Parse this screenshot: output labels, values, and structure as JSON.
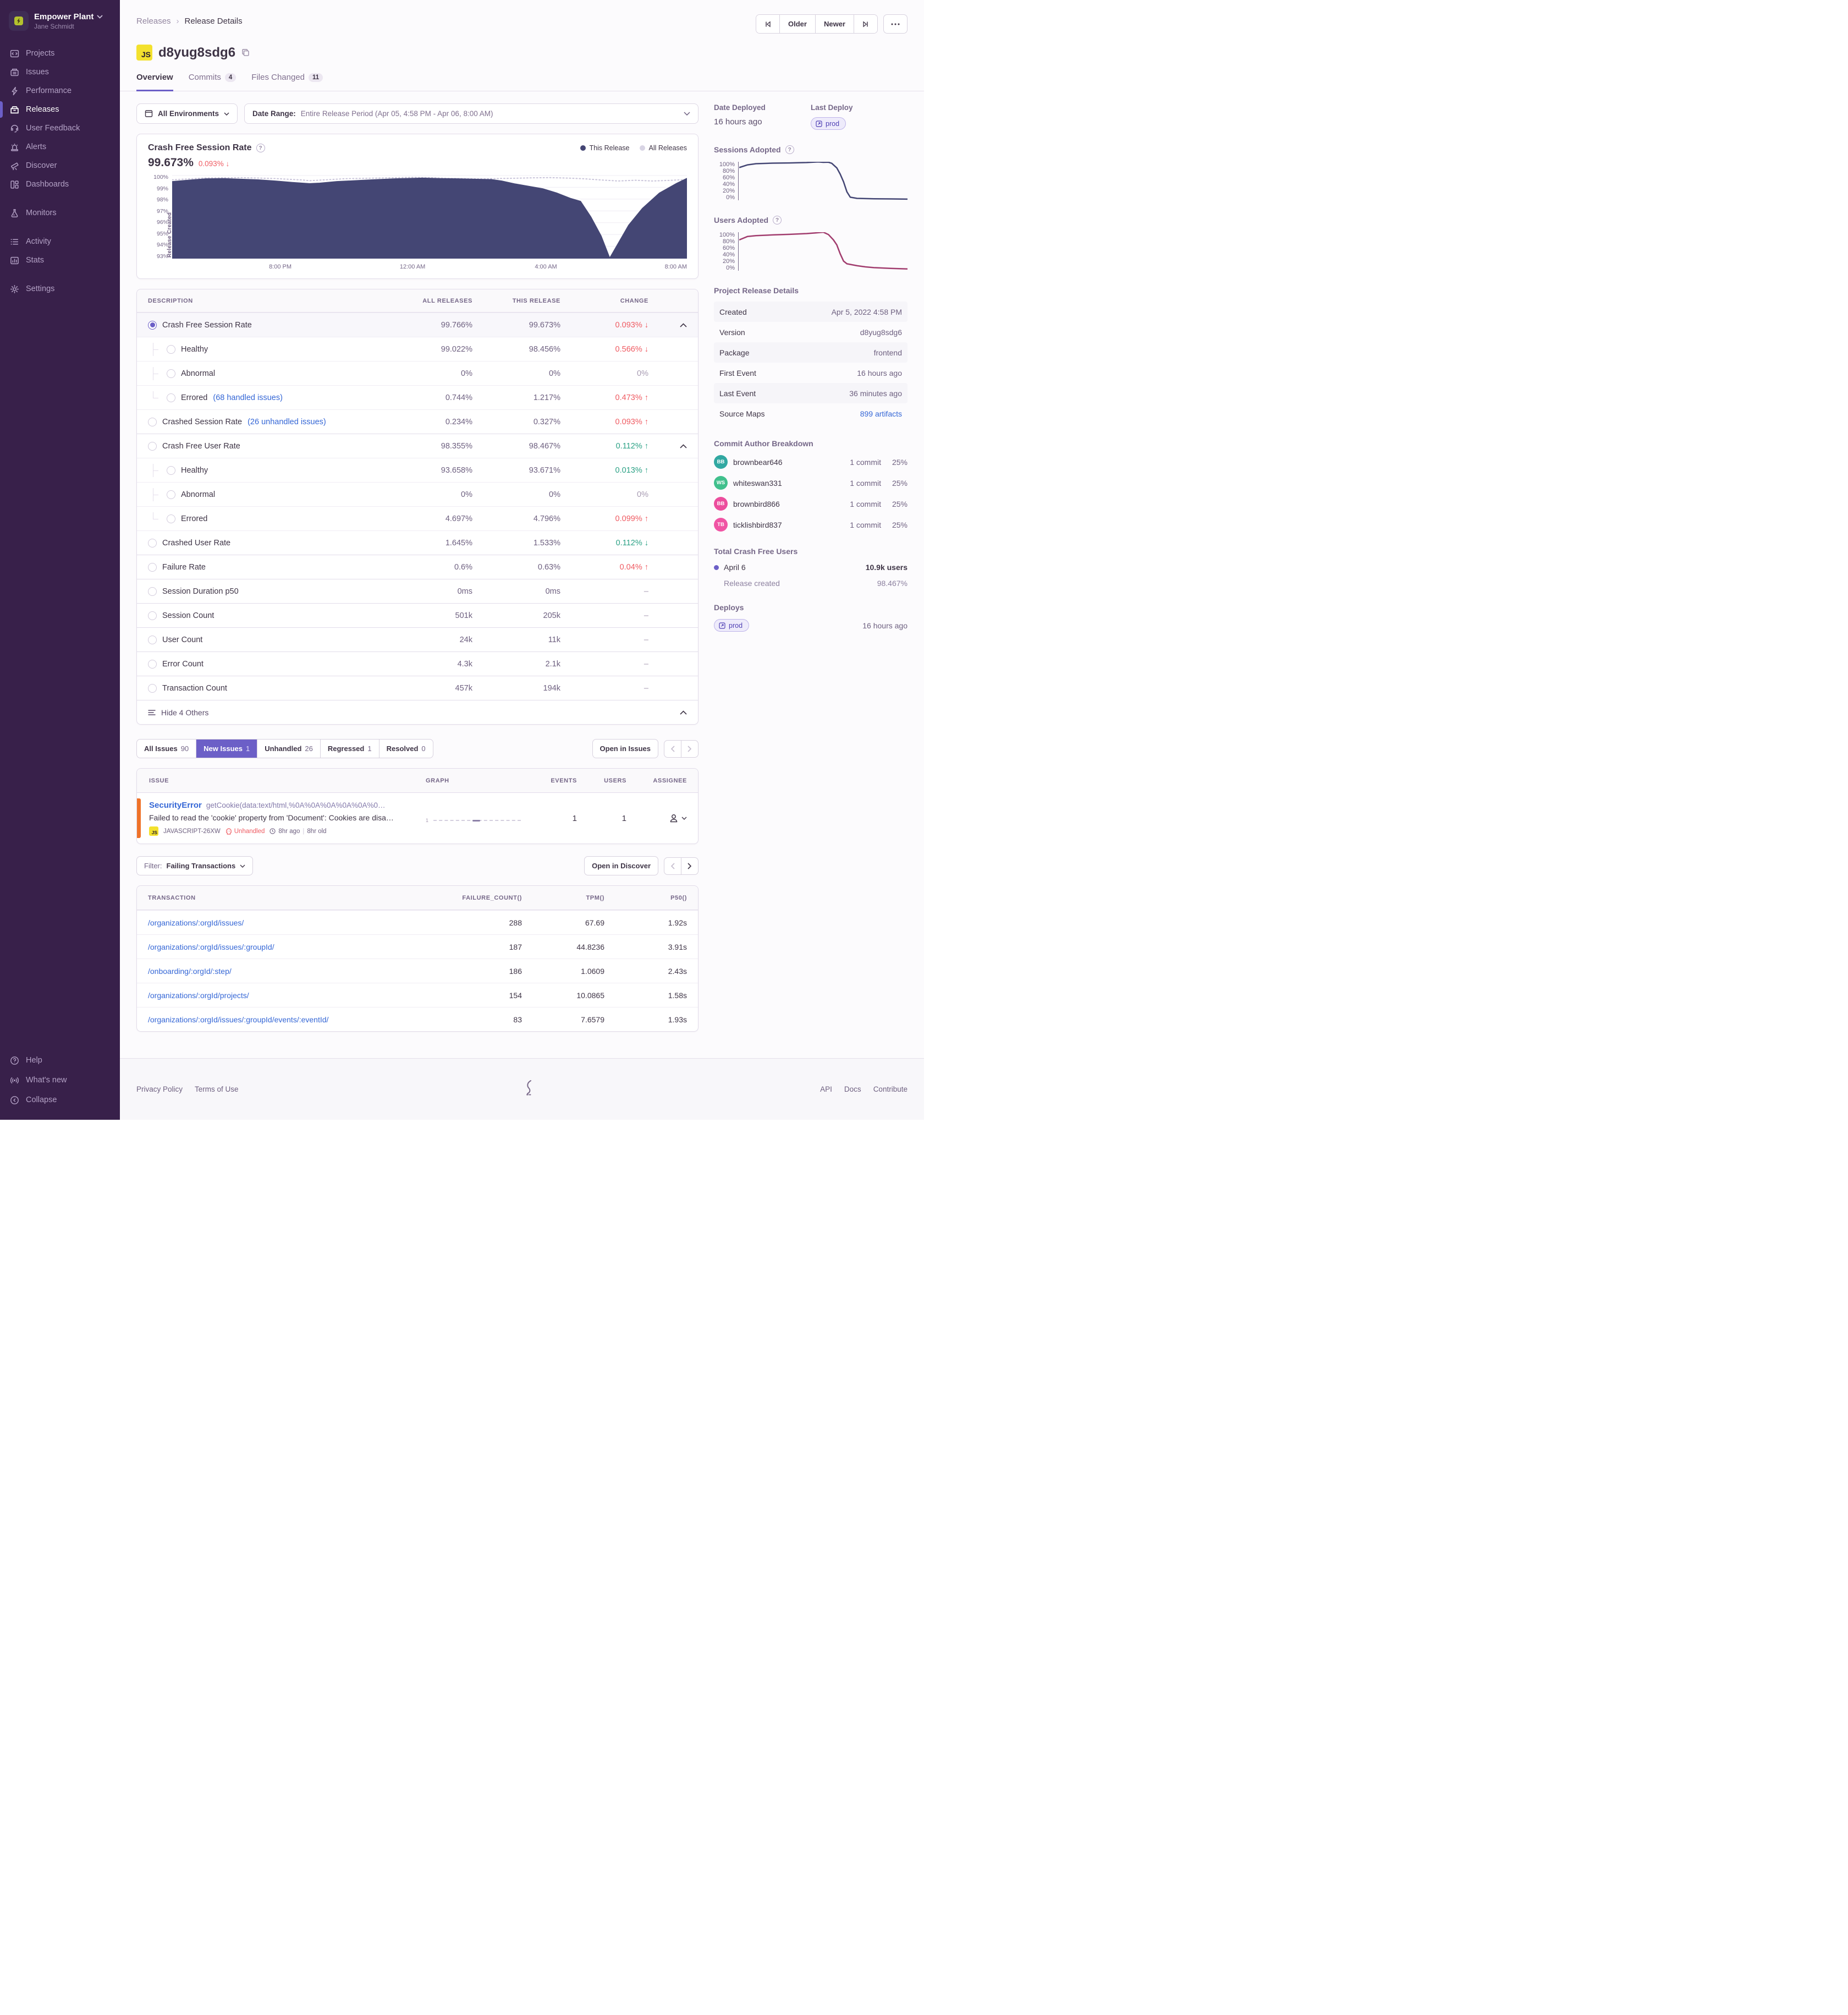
{
  "colors": {
    "accent_purple": "#6c5fc7",
    "sidebar_bg": "#38204a",
    "chart_navy": "#444674",
    "chart_magenta": "#a13c6e",
    "all_releases_line": "#c9c4da",
    "red": "#ef5b62",
    "green": "#2ba185",
    "link_blue": "#3567d6",
    "js_badge_yellow": "#f3e12e",
    "issue_level_orange": "#ef7229"
  },
  "sidebar": {
    "org_name": "Empower Plant",
    "user_name": "Jane Schmidt",
    "items": [
      {
        "label": "Projects"
      },
      {
        "label": "Issues"
      },
      {
        "label": "Performance"
      },
      {
        "label": "Releases"
      },
      {
        "label": "User Feedback"
      },
      {
        "label": "Alerts"
      },
      {
        "label": "Discover"
      },
      {
        "label": "Dashboards"
      },
      {
        "label": "Monitors"
      },
      {
        "label": "Activity"
      },
      {
        "label": "Stats"
      },
      {
        "label": "Settings"
      }
    ],
    "footer_items": [
      {
        "label": "Help"
      },
      {
        "label": "What's new"
      },
      {
        "label": "Collapse"
      }
    ]
  },
  "topbar": {
    "breadcrumb": [
      "Releases",
      "Release Details"
    ],
    "older_label": "Older",
    "newer_label": "Newer"
  },
  "header": {
    "project_badge": "JS",
    "title": "d8yug8sdg6",
    "tabs": [
      {
        "label": "Overview",
        "count": ""
      },
      {
        "label": "Commits",
        "count": "4"
      },
      {
        "label": "Files Changed",
        "count": "11"
      }
    ]
  },
  "filters": {
    "environments": "All Environments",
    "date_range_label": "Date Range:",
    "date_range_value": "Entire Release Period (Apr 05, 4:58 PM - Apr 06, 8:00 AM)"
  },
  "crash_chart": {
    "title": "Crash Free Session Rate",
    "value": "99.673%",
    "delta": "0.093% ↓",
    "legend": [
      {
        "label": "This Release"
      },
      {
        "label": "All Releases"
      }
    ],
    "y_ticks": [
      "100%",
      "99%",
      "98%",
      "97%",
      "96%",
      "95%",
      "94%",
      "93%"
    ],
    "x_ticks": [
      "8:00 PM",
      "12:00 AM",
      "4:00 AM",
      "8:00 AM"
    ],
    "annotation": "Release Created"
  },
  "chart_data": {
    "crash_free_sessions": {
      "type": "area",
      "title": "Crash Free Session Rate (%) over release period Apr 05 4:58 PM - Apr 06 8:00 AM",
      "xlim": [
        0,
        15
      ],
      "ylim": [
        93,
        100
      ],
      "grid_lines": 8,
      "x_tick_labels": [
        "8:00 PM",
        "12:00 AM",
        "4:00 AM",
        "8:00 AM"
      ],
      "series": [
        {
          "name": "All Releases",
          "color": "#c9c4da",
          "width": 2,
          "dash": "2 4",
          "points": [
            [
              0,
              99.6
            ],
            [
              1,
              99.75
            ],
            [
              2,
              99.78
            ],
            [
              3,
              99.7
            ],
            [
              3.8,
              99.58
            ],
            [
              4,
              99.52
            ],
            [
              4.5,
              99.6
            ],
            [
              5,
              99.68
            ],
            [
              6,
              99.74
            ],
            [
              7,
              99.8
            ],
            [
              7.5,
              99.78
            ],
            [
              8,
              99.72
            ],
            [
              8.5,
              99.7
            ],
            [
              9,
              99.68
            ],
            [
              9.5,
              99.7
            ],
            [
              10,
              99.73
            ],
            [
              10.5,
              99.76
            ],
            [
              11,
              99.78
            ],
            [
              11.5,
              99.74
            ],
            [
              12,
              99.68
            ],
            [
              12.5,
              99.58
            ],
            [
              13,
              99.5
            ],
            [
              13.5,
              99.56
            ],
            [
              14,
              99.5
            ],
            [
              14.5,
              99.55
            ],
            [
              15,
              99.62
            ]
          ]
        },
        {
          "name": "This Release",
          "color": "#444674",
          "width": 1.5,
          "area": true,
          "points": [
            [
              0,
              99.45
            ],
            [
              0.6,
              99.6
            ],
            [
              1,
              99.68
            ],
            [
              1.5,
              99.7
            ],
            [
              2,
              99.65
            ],
            [
              2.5,
              99.6
            ],
            [
              3,
              99.5
            ],
            [
              3.5,
              99.38
            ],
            [
              4,
              99.28
            ],
            [
              4.3,
              99.32
            ],
            [
              4.8,
              99.45
            ],
            [
              5.5,
              99.55
            ],
            [
              6,
              99.62
            ],
            [
              6.5,
              99.68
            ],
            [
              7,
              99.72
            ],
            [
              7.3,
              99.74
            ],
            [
              7.8,
              99.7
            ],
            [
              8.3,
              99.68
            ],
            [
              8.8,
              99.65
            ],
            [
              9.3,
              99.62
            ],
            [
              9.6,
              99.5
            ],
            [
              10,
              99.25
            ],
            [
              10.4,
              99.05
            ],
            [
              10.8,
              98.85
            ],
            [
              11.2,
              98.5
            ],
            [
              11.6,
              98.05
            ],
            [
              11.9,
              97.8
            ],
            [
              12.2,
              96.5
            ],
            [
              12.5,
              94.9
            ],
            [
              12.75,
              93.05
            ],
            [
              13,
              94.3
            ],
            [
              13.3,
              95.8
            ],
            [
              13.7,
              97.2
            ],
            [
              14.2,
              98.5
            ],
            [
              14.7,
              99.3
            ],
            [
              15,
              99.72
            ]
          ]
        }
      ]
    },
    "sessions_adopted": {
      "type": "line",
      "title": "Sessions Adopted (%)",
      "xlim": [
        0,
        1
      ],
      "ylim": [
        0,
        100
      ],
      "grid_lines": 0,
      "series": [
        {
          "name": "Sessions Adopted",
          "color": "#444674",
          "width": 2.5,
          "points": [
            [
              0,
              85
            ],
            [
              0.05,
              92
            ],
            [
              0.1,
              95
            ],
            [
              0.2,
              96.5
            ],
            [
              0.3,
              97
            ],
            [
              0.4,
              98
            ],
            [
              0.47,
              99.5
            ],
            [
              0.5,
              98.5
            ],
            [
              0.53,
              98.8
            ],
            [
              0.55,
              96
            ],
            [
              0.58,
              84
            ],
            [
              0.6,
              68
            ],
            [
              0.62,
              48
            ],
            [
              0.64,
              22
            ],
            [
              0.66,
              8
            ],
            [
              0.7,
              5
            ],
            [
              0.8,
              4
            ],
            [
              0.9,
              3.5
            ],
            [
              1,
              3
            ]
          ]
        }
      ]
    },
    "users_adopted": {
      "type": "line",
      "title": "Users Adopted (%)",
      "xlim": [
        0,
        1
      ],
      "ylim": [
        0,
        100
      ],
      "grid_lines": 0,
      "series": [
        {
          "name": "Users Adopted",
          "color": "#a13c6e",
          "width": 2.5,
          "points": [
            [
              0,
              80
            ],
            [
              0.05,
              89
            ],
            [
              0.1,
              91
            ],
            [
              0.2,
              93
            ],
            [
              0.3,
              94.5
            ],
            [
              0.4,
              96.5
            ],
            [
              0.45,
              98
            ],
            [
              0.5,
              100
            ],
            [
              0.53,
              94
            ],
            [
              0.56,
              80
            ],
            [
              0.58,
              67
            ],
            [
              0.6,
              44
            ],
            [
              0.62,
              25
            ],
            [
              0.64,
              18
            ],
            [
              0.7,
              13
            ],
            [
              0.75,
              10
            ],
            [
              0.8,
              8
            ],
            [
              0.9,
              6
            ],
            [
              1,
              4.5
            ]
          ]
        }
      ]
    }
  },
  "metrics_table": {
    "headers": [
      "DESCRIPTION",
      "ALL RELEASES",
      "THIS RELEASE",
      "CHANGE"
    ],
    "rows": [
      {
        "label": "Crash Free Session Rate",
        "link": "",
        "all": "99.766%",
        "this": "99.673%",
        "change": "0.093% ↓",
        "trend": "red",
        "radio": "on"
      },
      {
        "label": "Healthy",
        "link": "",
        "all": "99.022%",
        "this": "98.456%",
        "change": "0.566% ↓",
        "trend": "red",
        "radio": "off"
      },
      {
        "label": "Abnormal",
        "link": "",
        "all": "0%",
        "this": "0%",
        "change": "0%",
        "trend": "muted",
        "radio": "off"
      },
      {
        "label": "Errored",
        "link": "(68 handled issues)",
        "all": "0.744%",
        "this": "1.217%",
        "change": "0.473% ↑",
        "trend": "red",
        "radio": "off"
      },
      {
        "label": "Crashed Session Rate",
        "link": "(26 unhandled issues)",
        "all": "0.234%",
        "this": "0.327%",
        "change": "0.093% ↑",
        "trend": "red",
        "radio": "off"
      },
      {
        "label": "Crash Free User Rate",
        "link": "",
        "all": "98.355%",
        "this": "98.467%",
        "change": "0.112% ↑",
        "trend": "green",
        "radio": "off"
      },
      {
        "label": "Healthy",
        "link": "",
        "all": "93.658%",
        "this": "93.671%",
        "change": "0.013% ↑",
        "trend": "green",
        "radio": "off"
      },
      {
        "label": "Abnormal",
        "link": "",
        "all": "0%",
        "this": "0%",
        "change": "0%",
        "trend": "muted",
        "radio": "off"
      },
      {
        "label": "Errored",
        "link": "",
        "all": "4.697%",
        "this": "4.796%",
        "change": "0.099% ↑",
        "trend": "red",
        "radio": "off"
      },
      {
        "label": "Crashed User Rate",
        "link": "",
        "all": "1.645%",
        "this": "1.533%",
        "change": "0.112% ↓",
        "trend": "green",
        "radio": "off"
      },
      {
        "label": "Failure Rate",
        "link": "",
        "all": "0.6%",
        "this": "0.63%",
        "change": "0.04% ↑",
        "trend": "red",
        "radio": "off"
      },
      {
        "label": "Session Duration p50",
        "link": "",
        "all": "0ms",
        "this": "0ms",
        "change": "–",
        "trend": "muted",
        "radio": "off"
      },
      {
        "label": "Session Count",
        "link": "",
        "all": "501k",
        "this": "205k",
        "change": "–",
        "trend": "muted",
        "radio": "off"
      },
      {
        "label": "User Count",
        "link": "",
        "all": "24k",
        "this": "11k",
        "change": "–",
        "trend": "muted",
        "radio": "off"
      },
      {
        "label": "Error Count",
        "link": "",
        "all": "4.3k",
        "this": "2.1k",
        "change": "–",
        "trend": "muted",
        "radio": "off"
      },
      {
        "label": "Transaction Count",
        "link": "",
        "all": "457k",
        "this": "194k",
        "change": "–",
        "trend": "muted",
        "radio": "off"
      }
    ],
    "footer_label": "Hide 4 Others"
  },
  "issues": {
    "tabs": [
      {
        "label": "All Issues",
        "count": "90"
      },
      {
        "label": "New Issues",
        "count": "1"
      },
      {
        "label": "Unhandled",
        "count": "26"
      },
      {
        "label": "Regressed",
        "count": "1"
      },
      {
        "label": "Resolved",
        "count": "0"
      }
    ],
    "open_button": "Open in Issues",
    "headers": [
      "ISSUE",
      "GRAPH",
      "EVENTS",
      "USERS",
      "ASSIGNEE"
    ],
    "row": {
      "type": "SecurityError",
      "culprit": "getCookie(data:text/html,%0A%0A%0A%0A%0A%0…",
      "message": "Failed to read the 'cookie' property from 'Document': Cookies are disa…",
      "project_badge": "JS",
      "short_id": "JAVASCRIPT-26XW",
      "unhandled_label": "Unhandled",
      "time_ago": "8hr ago",
      "age": "8hr old",
      "graph_axis_label": "1",
      "events": "1",
      "users": "1"
    }
  },
  "transactions": {
    "filter_label": "Filter:",
    "filter_value": "Failing Transactions",
    "open_button": "Open in Discover",
    "headers": [
      "TRANSACTION",
      "FAILURE_COUNT()",
      "TPM()",
      "P50()"
    ],
    "rows": [
      {
        "transaction": "/organizations/:orgId/issues/",
        "failure_count": "288",
        "tpm": "67.69",
        "p50": "1.92s"
      },
      {
        "transaction": "/organizations/:orgId/issues/:groupId/",
        "failure_count": "187",
        "tpm": "44.8236",
        "p50": "3.91s"
      },
      {
        "transaction": "/onboarding/:orgId/:step/",
        "failure_count": "186",
        "tpm": "1.0609",
        "p50": "2.43s"
      },
      {
        "transaction": "/organizations/:orgId/projects/",
        "failure_count": "154",
        "tpm": "10.0865",
        "p50": "1.58s"
      },
      {
        "transaction": "/organizations/:orgId/issues/:groupId/events/:eventId/",
        "failure_count": "83",
        "tpm": "7.6579",
        "p50": "1.93s"
      }
    ]
  },
  "right_panel": {
    "date_deployed_label": "Date Deployed",
    "date_deployed_value": "16 hours ago",
    "last_deploy_label": "Last Deploy",
    "last_deploy_badge": "prod",
    "sessions_adopted_title": "Sessions Adopted",
    "users_adopted_title": "Users Adopted",
    "adoption_y_ticks": [
      "100%",
      "80%",
      "60%",
      "40%",
      "20%",
      "0%"
    ],
    "details_title": "Project Release Details",
    "details": [
      {
        "key": "Created",
        "value": "Apr 5, 2022 4:58 PM",
        "link": false
      },
      {
        "key": "Version",
        "value": "d8yug8sdg6",
        "link": false
      },
      {
        "key": "Package",
        "value": "frontend",
        "link": false
      },
      {
        "key": "First Event",
        "value": "16 hours ago",
        "link": false
      },
      {
        "key": "Last Event",
        "value": "36 minutes ago",
        "link": false
      },
      {
        "key": "Source Maps",
        "value": "899 artifacts",
        "link": true
      }
    ],
    "authors_title": "Commit Author Breakdown",
    "authors": [
      {
        "initials": "BB",
        "name": "brownbear646",
        "commits": "1 commit",
        "pct": "25%",
        "color": "#31a8a2"
      },
      {
        "initials": "WS",
        "name": "whiteswan331",
        "commits": "1 commit",
        "pct": "25%",
        "color": "#41c08d"
      },
      {
        "initials": "BB",
        "name": "brownbird866",
        "commits": "1 commit",
        "pct": "25%",
        "color": "#ec4d9d"
      },
      {
        "initials": "TB",
        "name": "ticklishbird837",
        "commits": "1 commit",
        "pct": "25%",
        "color": "#f054a4"
      }
    ],
    "tcfu_title": "Total Crash Free Users",
    "tcfu_date": "April 6",
    "tcfu_users": "10.9k users",
    "tcfu_sub_label": "Release created",
    "tcfu_sub_value": "98.467%",
    "deploys_title": "Deploys",
    "deploys_badge": "prod",
    "deploys_time": "16 hours ago"
  },
  "footer": {
    "left_links": [
      "Privacy Policy",
      "Terms of Use"
    ],
    "right_links": [
      "API",
      "Docs",
      "Contribute"
    ]
  }
}
